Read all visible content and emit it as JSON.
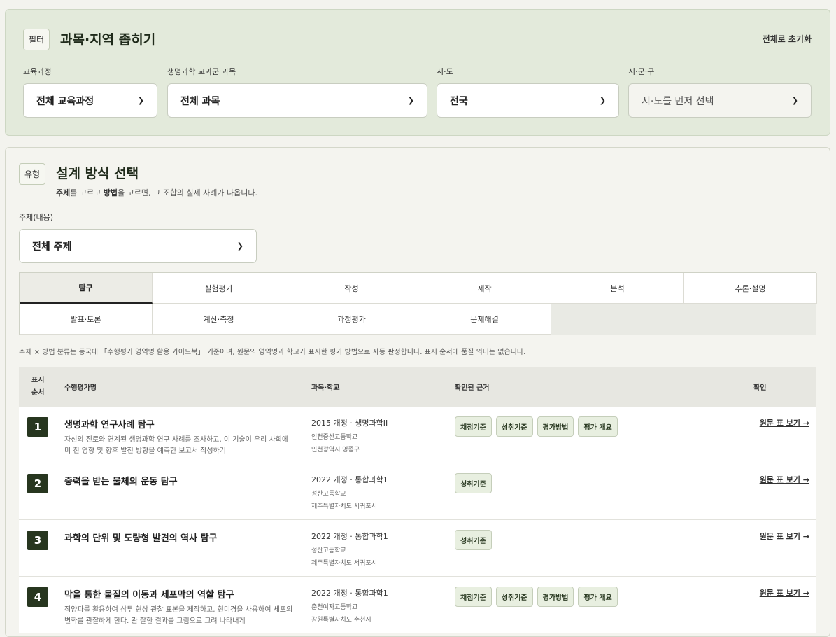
{
  "filter": {
    "tag": "필터",
    "title": "과목·지역 좁히기",
    "reset": "전체로 초기화",
    "fields": [
      {
        "label": "교육과정",
        "value": "전체 교육과정"
      },
      {
        "label": "생명과학 교과군 과목",
        "value": "전체 과목"
      },
      {
        "label": "시·도",
        "value": "전국"
      },
      {
        "label": "시·군·구",
        "value": "시·도를 먼저 선택"
      }
    ]
  },
  "design": {
    "tag": "유형",
    "title": "설계 방식 선택",
    "sub_topic": "주제",
    "sub_mid": "를 고르고 ",
    "sub_method": "방법",
    "sub_end": "을 고르면, 그 조합의 실제 사례가 나옵니다.",
    "topic_label": "주제(내용)",
    "topic_value": "전체 주제",
    "methods": [
      "탐구",
      "실험평가",
      "작성",
      "제작",
      "분석",
      "추론·설명",
      "발표·토론",
      "계산·측정",
      "과정평가",
      "문제해결"
    ],
    "footnote": "주제 × 방법 분류는 동국대 「수행평가 영역명 활용 가이드북」 기준이며, 원문의 영역명과 학교가 표시한 평가 방법으로 자동 판정합니다. 표시 순서에 품질 의미는 없습니다."
  },
  "table": {
    "headers": {
      "order": "표시\n순서",
      "name": "수행평가명",
      "course": "과목·학교",
      "evidence": "확인된 근거",
      "confirm": "확인"
    },
    "link_label": "원문 표 보기 →",
    "rows": [
      {
        "num": "1",
        "title": "생명과학 연구사례 탐구",
        "desc": "자신의 진로와 연계된 생명과학 연구 사례를 조사하고, 이 기술이 우리 사회에 미 친 영향 및 향후 발전 방향을 예측한 보고서 작성하기",
        "course": "2015 개정 · 생명과학II",
        "school": "인천중산고등학교",
        "region": "인천광역시 영종구",
        "badges": [
          "채점기준",
          "성취기준",
          "평가방법",
          "평가 개요"
        ]
      },
      {
        "num": "2",
        "title": "중력을 받는 물체의 운동 탐구",
        "desc": "",
        "course": "2022 개정 · 통합과학1",
        "school": "성산고등학교",
        "region": "제주특별자치도 서귀포시",
        "badges": [
          "성취기준"
        ]
      },
      {
        "num": "3",
        "title": "과학의 단위 및 도량형 발견의 역사 탐구",
        "desc": "",
        "course": "2022 개정 · 통합과학1",
        "school": "성산고등학교",
        "region": "제주특별자치도 서귀포시",
        "badges": [
          "성취기준"
        ]
      },
      {
        "num": "4",
        "title": "막을 통한 물질의 이동과 세포막의 역할 탐구",
        "desc": "적양파를 활용하여 삼투 현상 관찰 표본을 제작하고, 현미경을 사용하여 세포의 변화를 관찰하게 한다. 관 찰한 결과를 그림으로 그려 나타내게",
        "course": "2022 개정 · 통합과학1",
        "school": "춘천여자고등학교",
        "region": "강원특별자치도 춘천시",
        "badges": [
          "채점기준",
          "성취기준",
          "평가방법",
          "평가 개요"
        ]
      }
    ]
  }
}
